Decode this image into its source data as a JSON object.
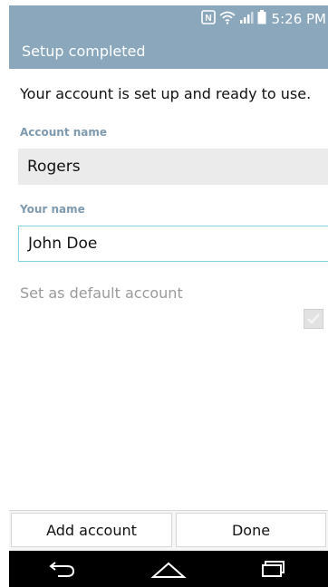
{
  "status_bar": {
    "time": "5:26 PM",
    "icons": [
      "nfc-icon",
      "wifi-icon",
      "signal-icon",
      "battery-icon"
    ]
  },
  "header": {
    "title": "Setup completed"
  },
  "main": {
    "intro_text": "Your account is set up and ready to use.",
    "account_name": {
      "label": "Account name",
      "value": "Rogers"
    },
    "your_name": {
      "label": "Your name",
      "value": "John Doe"
    },
    "default_account": {
      "label": "Set as default account",
      "checked": true,
      "enabled": false
    }
  },
  "actions": {
    "add_account": "Add account",
    "done": "Done"
  },
  "nav": {
    "icons": [
      "back-icon",
      "home-icon",
      "recents-icon"
    ]
  },
  "colors": {
    "header_bg": "#8aa7bc",
    "label_color": "#7f9aaf",
    "focus_border": "#7fd3e3"
  }
}
